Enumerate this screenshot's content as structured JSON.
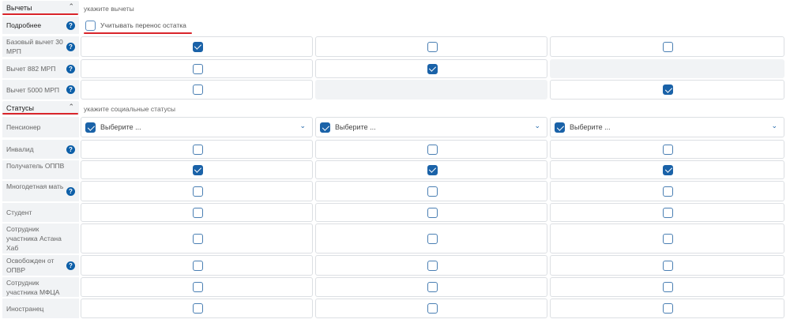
{
  "deductions": {
    "title": "Вычеты",
    "hint": "укажите вычеты",
    "details_label": "Подробнее",
    "carry_label": "Учитывать перенос остатка",
    "rows": [
      {
        "label": "Базовый вычет 30 МРП",
        "help": true,
        "cols": [
          "checked",
          "unchecked",
          "unchecked"
        ]
      },
      {
        "label": "Вычет 882 МРП",
        "help": true,
        "cols": [
          "unchecked",
          "checked",
          "empty"
        ]
      },
      {
        "label": "Вычет 5000 МРП",
        "help": true,
        "cols": [
          "unchecked",
          "empty",
          "checked"
        ]
      }
    ]
  },
  "statuses": {
    "title": "Статусы",
    "hint": "укажите социальные статусы",
    "pensioner": {
      "label": "Пенсионер",
      "placeholder": "Выберите ..."
    },
    "rows": [
      {
        "label": "Инвалид",
        "help": true,
        "cols": [
          "unchecked",
          "unchecked",
          "unchecked"
        ]
      },
      {
        "label": "Получатель ОППВ",
        "help": false,
        "cols": [
          "checked",
          "checked",
          "checked"
        ]
      },
      {
        "label": "Многодетная мать",
        "help": true,
        "cols": [
          "unchecked",
          "unchecked",
          "unchecked"
        ]
      },
      {
        "label": "Студент",
        "help": false,
        "cols": [
          "unchecked",
          "unchecked",
          "unchecked"
        ]
      },
      {
        "label": "Сотрудник участника Астана Хаб",
        "help": false,
        "cols": [
          "unchecked",
          "unchecked",
          "unchecked"
        ]
      },
      {
        "label": "Освобожден от ОПВР",
        "help": true,
        "cols": [
          "unchecked",
          "unchecked",
          "unchecked"
        ]
      },
      {
        "label": "Сотрудник участника МФЦА",
        "help": false,
        "cols": [
          "unchecked",
          "unchecked",
          "unchecked"
        ]
      },
      {
        "label": "Иностранец",
        "help": false,
        "cols": [
          "unchecked",
          "unchecked",
          "unchecked"
        ]
      }
    ]
  },
  "icons": {
    "help": "question-circle-icon",
    "collapse": "chevron-up-icon",
    "dropdown": "chevron-down-icon"
  },
  "colors": {
    "accent": "#1a62a8",
    "underline": "#d9252b",
    "label_bg": "#f1f3f5"
  }
}
